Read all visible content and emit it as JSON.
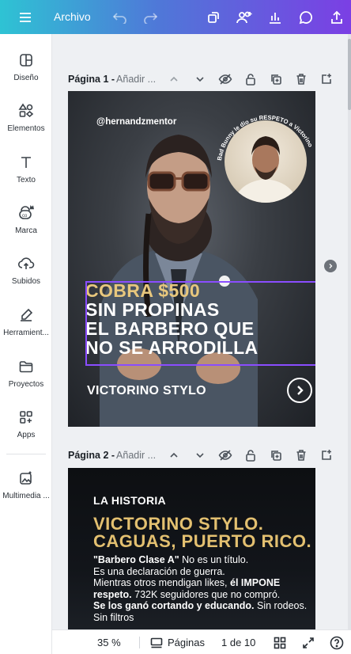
{
  "topbar": {
    "menu_icon": "hamburger-icon",
    "file_label": "Archivo",
    "undo_icon": "undo-icon",
    "redo_icon": "redo-icon",
    "icons": [
      "resize-icon",
      "share-people-icon",
      "chart-icon",
      "comment-icon",
      "upload-icon"
    ]
  },
  "sidebar": {
    "items": [
      {
        "label": "Diseño",
        "icon": "layout-icon"
      },
      {
        "label": "Elementos",
        "icon": "shapes-icon"
      },
      {
        "label": "Texto",
        "icon": "text-icon"
      },
      {
        "label": "Marca",
        "icon": "brand-icon"
      },
      {
        "label": "Subidos",
        "icon": "cloud-upload-icon"
      },
      {
        "label": "Herramient...",
        "icon": "tools-icon"
      },
      {
        "label": "Proyectos",
        "icon": "folder-icon"
      },
      {
        "label": "Apps",
        "icon": "apps-icon"
      },
      {
        "label": "Multimedia ...",
        "icon": "magic-media-icon"
      }
    ]
  },
  "pages": [
    {
      "title": "Página 1 -",
      "add_title": "Añadir ...",
      "handle": "@hernandzmentor",
      "circle_caption": "Bad Bunny le dio su RESPETO a Victorino",
      "headline_lines": [
        "COBRA $500",
        "SIN PROPINAS",
        "EL BARBERO QUE",
        "NO SE ARRODILLA"
      ],
      "brand": "VICTORINO STYLO"
    },
    {
      "title": "Página 2 -",
      "add_title": "Añadir ...",
      "kicker": "LA HISTORIA",
      "title_lines": [
        "VICTORINO STYLO.",
        "CAGUAS, PUERTO RICO."
      ],
      "body": {
        "b1": "\"Barbero Clase A\"",
        "t1": " No es un título.",
        "t2": "Es una declaración de guerra.",
        "t3": "Mientras otros mendigan likes, ",
        "b2": "él IMPONE respeto.",
        "t4": " 732K seguidores que no compró.",
        "b3": "Se los ganó cortando y educando.",
        "t5": " Sin rodeos. Sin filtros"
      }
    }
  ],
  "bottombar": {
    "zoom": "35 %",
    "pages_label": "Páginas",
    "page_count": "1 de 10"
  },
  "colors": {
    "accent_gradient_start": "#2ec3d4",
    "accent_gradient_end": "#7b3fe4",
    "gold": "#e8c77d",
    "selection": "#8a4dff"
  }
}
